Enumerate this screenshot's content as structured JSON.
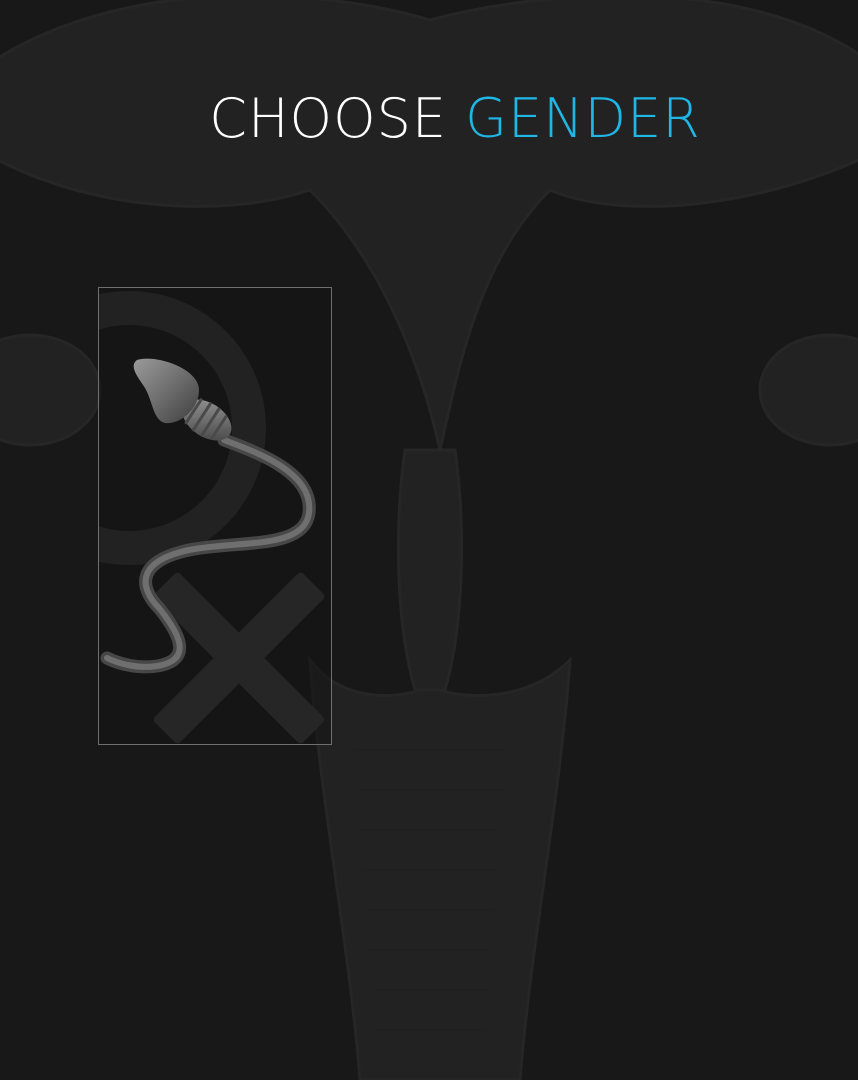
{
  "title": {
    "word1": "CHOOSE",
    "word2": "GENDER",
    "accent_color": "#1fb7e6"
  },
  "background": {
    "icon": "uterus-silhouette"
  },
  "options": [
    {
      "id": "sperm-option",
      "icon": "sperm-icon",
      "background_icon": "female-symbol-icon"
    }
  ]
}
